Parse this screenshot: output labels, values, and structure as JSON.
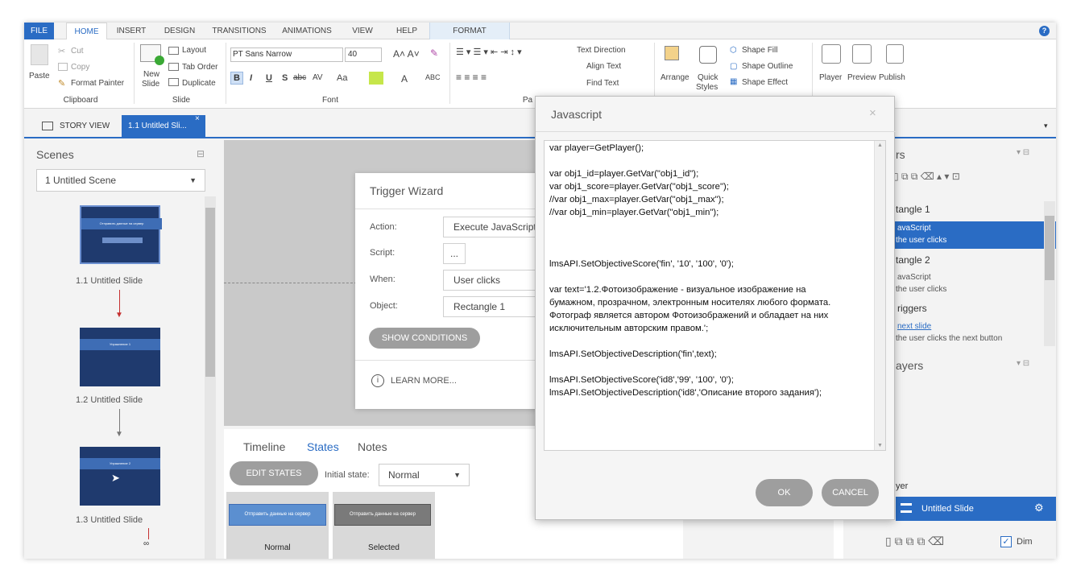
{
  "ribbon_tabs": [
    "FILE",
    "HOME",
    "INSERT",
    "DESIGN",
    "TRANSITIONS",
    "ANIMATIONS",
    "VIEW",
    "HELP",
    "FORMAT"
  ],
  "clipboard": {
    "paste": "Paste",
    "cut": "Cut",
    "copy": "Copy",
    "format_painter": "Format Painter",
    "group": "Clipboard"
  },
  "slide_group": {
    "new_slide_1": "New",
    "new_slide_2": "Slide",
    "layout": "Layout",
    "tab_order": "Tab Order",
    "duplicate": "Duplicate",
    "group": "Slide"
  },
  "font_group": {
    "font_name": "PT Sans Narrow",
    "font_size": "40",
    "group": "Font",
    "aa": "Aa",
    "a": "A"
  },
  "para_group": {
    "text_direction": "Text Direction",
    "align_text": "Align Text",
    "find_text": "Find Text",
    "group": "Pa"
  },
  "drawing_group": {
    "arrange": "Arrange",
    "quick_1": "Quick",
    "quick_2": "Styles",
    "shape_fill": "Shape Fill",
    "shape_outline": "Shape Outline",
    "shape_effect": "Shape Effect"
  },
  "publish_group": {
    "player": "Player",
    "preview": "Preview",
    "publish": "Publish"
  },
  "story_tabs": {
    "story_view": "STORY VIEW",
    "current": "1.1 Untitled Sli..."
  },
  "scenes": {
    "title": "Scenes",
    "dropdown": "1 Untitled Scene",
    "slides": [
      {
        "label": "1.1 Untitled Slide",
        "band": "Отправить данные на сервер"
      },
      {
        "label": "1.2 Untitled Slide",
        "band": "Упражнение 1"
      },
      {
        "label": "1.3 Untitled Slide",
        "band": "Упражнение 2"
      }
    ]
  },
  "wizard": {
    "title": "Trigger Wizard",
    "action_label": "Action:",
    "action_value": "Execute JavaScript",
    "script_label": "Script:",
    "script_value": "...",
    "when_label": "When:",
    "when_value": "User clicks",
    "object_label": "Object:",
    "object_value": "Rectangle 1",
    "show_conditions": "SHOW CONDITIONS",
    "learn_more": "LEARN MORE..."
  },
  "bottom_tabs": {
    "timeline": "Timeline",
    "states": "States",
    "notes": "Notes"
  },
  "states": {
    "edit": "EDIT STATES",
    "initial_label": "Initial state:",
    "initial_value": "Normal",
    "normal": "Normal",
    "selected": "Selected",
    "button_text": "Отправить данные на сервер"
  },
  "dialog": {
    "title": "Javascript",
    "close": "×",
    "ok": "OK",
    "cancel": "CANCEL",
    "lines": [
      "var player=GetPlayer();",
      "",
      "var obj1_id=player.GetVar(\"obj1_id\");",
      "var obj1_score=player.GetVar(\"obj1_score\");",
      "//var obj1_max=player.GetVar(\"obj1_max\");",
      "//var obj1_min=player.GetVar(\"obj1_min\");",
      "",
      "",
      "",
      "lmsAPI.SetObjectiveScore('fin', '10', '100', '0');",
      "",
      "var text='1.2.Фотоизображение -  визуальное изображение на",
      "бумажном, прозрачном, электронным носителях любого формата.",
      "Фотограф является автором Фотоизображений и обладает на них",
      "исключительным авторским правом.';",
      "",
      "lmsAPI.SetObjectiveDescription('fin',text);",
      "",
      "lmsAPI.SetObjectiveScore('id8','99', '100', '0');",
      "lmsAPI.SetObjectiveDescription('id8','Описание второго задания');"
    ]
  },
  "right_panel": {
    "triggers_title": "rs",
    "items": [
      {
        "text": "tangle 1"
      },
      {
        "text": "avaScript",
        "sub": "the user clicks",
        "selected": true
      },
      {
        "text": "tangle 2"
      },
      {
        "text": "avaScript",
        "sub": "the user clicks"
      },
      {
        "text": "riggers"
      },
      {
        "text": "next slide",
        "sub": "the user clicks the next button",
        "link": true
      }
    ],
    "layers_title": "ayers",
    "player_label": "yer",
    "base_layer": "Untitled Slide",
    "dim": "Dim"
  }
}
